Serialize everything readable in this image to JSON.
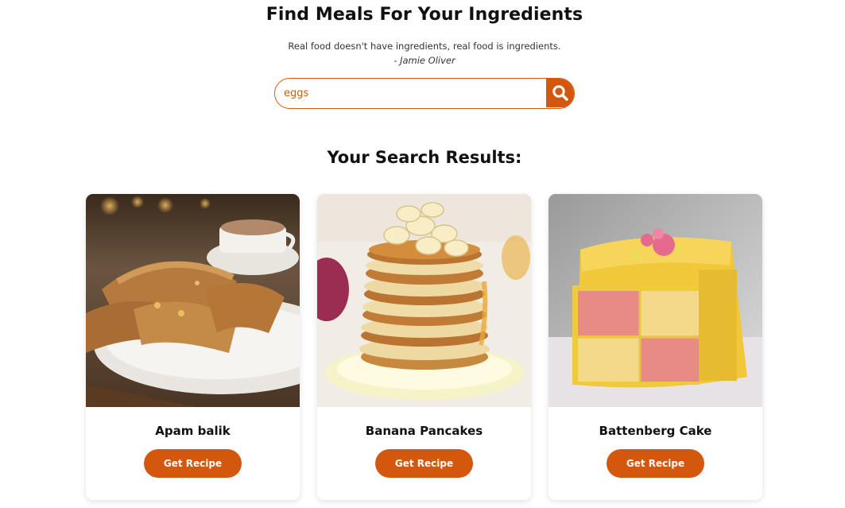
{
  "header": {
    "title": "Find Meals For Your Ingredients",
    "quote": "Real food doesn't have ingredients, real food is ingredients.",
    "quote_author": "- Jamie Oliver"
  },
  "search": {
    "value": "eggs",
    "button_icon": "search-icon"
  },
  "results": {
    "title": "Your Search Results:",
    "meals": [
      {
        "name": "Apam balik",
        "button_label": "Get Recipe"
      },
      {
        "name": "Banana Pancakes",
        "button_label": "Get Recipe"
      },
      {
        "name": "Battenberg Cake",
        "button_label": "Get Recipe"
      }
    ]
  },
  "colors": {
    "accent": "#d4570e",
    "text": "#111111"
  }
}
